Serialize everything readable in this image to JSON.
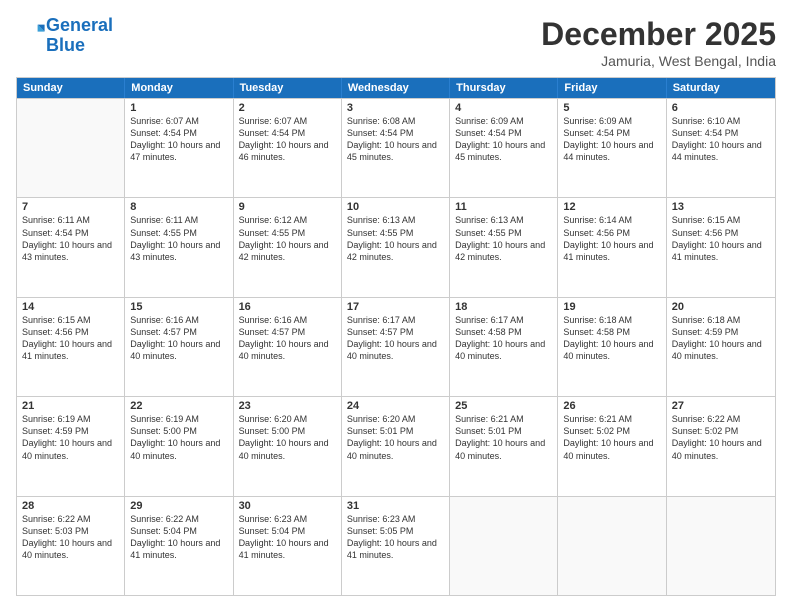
{
  "logo": {
    "line1": "General",
    "line2": "Blue"
  },
  "title": {
    "month_year": "December 2025",
    "location": "Jamuria, West Bengal, India"
  },
  "days_of_week": [
    "Sunday",
    "Monday",
    "Tuesday",
    "Wednesday",
    "Thursday",
    "Friday",
    "Saturday"
  ],
  "weeks": [
    [
      {
        "num": "",
        "sunrise": "",
        "sunset": "",
        "daylight": ""
      },
      {
        "num": "1",
        "sunrise": "Sunrise: 6:07 AM",
        "sunset": "Sunset: 4:54 PM",
        "daylight": "Daylight: 10 hours and 47 minutes."
      },
      {
        "num": "2",
        "sunrise": "Sunrise: 6:07 AM",
        "sunset": "Sunset: 4:54 PM",
        "daylight": "Daylight: 10 hours and 46 minutes."
      },
      {
        "num": "3",
        "sunrise": "Sunrise: 6:08 AM",
        "sunset": "Sunset: 4:54 PM",
        "daylight": "Daylight: 10 hours and 45 minutes."
      },
      {
        "num": "4",
        "sunrise": "Sunrise: 6:09 AM",
        "sunset": "Sunset: 4:54 PM",
        "daylight": "Daylight: 10 hours and 45 minutes."
      },
      {
        "num": "5",
        "sunrise": "Sunrise: 6:09 AM",
        "sunset": "Sunset: 4:54 PM",
        "daylight": "Daylight: 10 hours and 44 minutes."
      },
      {
        "num": "6",
        "sunrise": "Sunrise: 6:10 AM",
        "sunset": "Sunset: 4:54 PM",
        "daylight": "Daylight: 10 hours and 44 minutes."
      }
    ],
    [
      {
        "num": "7",
        "sunrise": "Sunrise: 6:11 AM",
        "sunset": "Sunset: 4:54 PM",
        "daylight": "Daylight: 10 hours and 43 minutes."
      },
      {
        "num": "8",
        "sunrise": "Sunrise: 6:11 AM",
        "sunset": "Sunset: 4:55 PM",
        "daylight": "Daylight: 10 hours and 43 minutes."
      },
      {
        "num": "9",
        "sunrise": "Sunrise: 6:12 AM",
        "sunset": "Sunset: 4:55 PM",
        "daylight": "Daylight: 10 hours and 42 minutes."
      },
      {
        "num": "10",
        "sunrise": "Sunrise: 6:13 AM",
        "sunset": "Sunset: 4:55 PM",
        "daylight": "Daylight: 10 hours and 42 minutes."
      },
      {
        "num": "11",
        "sunrise": "Sunrise: 6:13 AM",
        "sunset": "Sunset: 4:55 PM",
        "daylight": "Daylight: 10 hours and 42 minutes."
      },
      {
        "num": "12",
        "sunrise": "Sunrise: 6:14 AM",
        "sunset": "Sunset: 4:56 PM",
        "daylight": "Daylight: 10 hours and 41 minutes."
      },
      {
        "num": "13",
        "sunrise": "Sunrise: 6:15 AM",
        "sunset": "Sunset: 4:56 PM",
        "daylight": "Daylight: 10 hours and 41 minutes."
      }
    ],
    [
      {
        "num": "14",
        "sunrise": "Sunrise: 6:15 AM",
        "sunset": "Sunset: 4:56 PM",
        "daylight": "Daylight: 10 hours and 41 minutes."
      },
      {
        "num": "15",
        "sunrise": "Sunrise: 6:16 AM",
        "sunset": "Sunset: 4:57 PM",
        "daylight": "Daylight: 10 hours and 40 minutes."
      },
      {
        "num": "16",
        "sunrise": "Sunrise: 6:16 AM",
        "sunset": "Sunset: 4:57 PM",
        "daylight": "Daylight: 10 hours and 40 minutes."
      },
      {
        "num": "17",
        "sunrise": "Sunrise: 6:17 AM",
        "sunset": "Sunset: 4:57 PM",
        "daylight": "Daylight: 10 hours and 40 minutes."
      },
      {
        "num": "18",
        "sunrise": "Sunrise: 6:17 AM",
        "sunset": "Sunset: 4:58 PM",
        "daylight": "Daylight: 10 hours and 40 minutes."
      },
      {
        "num": "19",
        "sunrise": "Sunrise: 6:18 AM",
        "sunset": "Sunset: 4:58 PM",
        "daylight": "Daylight: 10 hours and 40 minutes."
      },
      {
        "num": "20",
        "sunrise": "Sunrise: 6:18 AM",
        "sunset": "Sunset: 4:59 PM",
        "daylight": "Daylight: 10 hours and 40 minutes."
      }
    ],
    [
      {
        "num": "21",
        "sunrise": "Sunrise: 6:19 AM",
        "sunset": "Sunset: 4:59 PM",
        "daylight": "Daylight: 10 hours and 40 minutes."
      },
      {
        "num": "22",
        "sunrise": "Sunrise: 6:19 AM",
        "sunset": "Sunset: 5:00 PM",
        "daylight": "Daylight: 10 hours and 40 minutes."
      },
      {
        "num": "23",
        "sunrise": "Sunrise: 6:20 AM",
        "sunset": "Sunset: 5:00 PM",
        "daylight": "Daylight: 10 hours and 40 minutes."
      },
      {
        "num": "24",
        "sunrise": "Sunrise: 6:20 AM",
        "sunset": "Sunset: 5:01 PM",
        "daylight": "Daylight: 10 hours and 40 minutes."
      },
      {
        "num": "25",
        "sunrise": "Sunrise: 6:21 AM",
        "sunset": "Sunset: 5:01 PM",
        "daylight": "Daylight: 10 hours and 40 minutes."
      },
      {
        "num": "26",
        "sunrise": "Sunrise: 6:21 AM",
        "sunset": "Sunset: 5:02 PM",
        "daylight": "Daylight: 10 hours and 40 minutes."
      },
      {
        "num": "27",
        "sunrise": "Sunrise: 6:22 AM",
        "sunset": "Sunset: 5:02 PM",
        "daylight": "Daylight: 10 hours and 40 minutes."
      }
    ],
    [
      {
        "num": "28",
        "sunrise": "Sunrise: 6:22 AM",
        "sunset": "Sunset: 5:03 PM",
        "daylight": "Daylight: 10 hours and 40 minutes."
      },
      {
        "num": "29",
        "sunrise": "Sunrise: 6:22 AM",
        "sunset": "Sunset: 5:04 PM",
        "daylight": "Daylight: 10 hours and 41 minutes."
      },
      {
        "num": "30",
        "sunrise": "Sunrise: 6:23 AM",
        "sunset": "Sunset: 5:04 PM",
        "daylight": "Daylight: 10 hours and 41 minutes."
      },
      {
        "num": "31",
        "sunrise": "Sunrise: 6:23 AM",
        "sunset": "Sunset: 5:05 PM",
        "daylight": "Daylight: 10 hours and 41 minutes."
      },
      {
        "num": "",
        "sunrise": "",
        "sunset": "",
        "daylight": ""
      },
      {
        "num": "",
        "sunrise": "",
        "sunset": "",
        "daylight": ""
      },
      {
        "num": "",
        "sunrise": "",
        "sunset": "",
        "daylight": ""
      }
    ]
  ]
}
